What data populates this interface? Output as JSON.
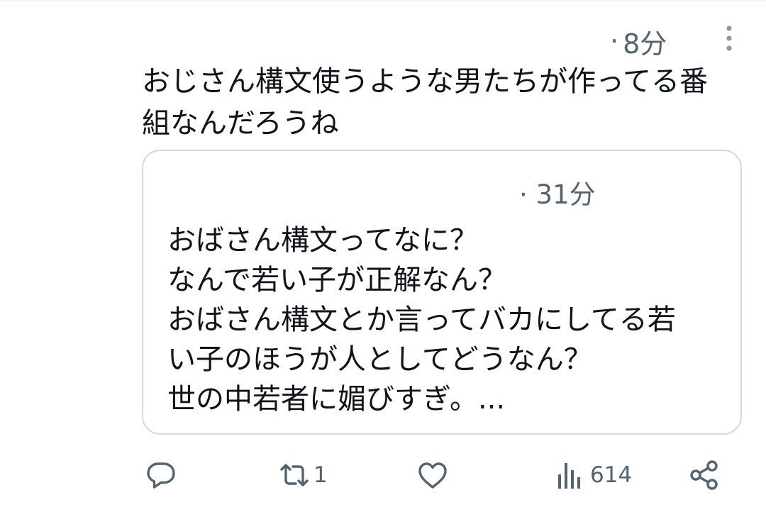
{
  "post": {
    "dot": "·",
    "time": "8分",
    "text": "おじさん構文使うような男たちが作ってる番\n組なんだろうね"
  },
  "quote": {
    "dot": "·",
    "time": "31分",
    "text": "おばさん構文ってなに？\nなんで若い子が正解なん？\nおばさん構文とか言ってバカにしてる若\nい子のほうが人としてどうなん？\n世の中若者に媚びすぎ。..."
  },
  "actions": {
    "reply_icon": "reply-icon",
    "retweet_icon": "retweet-icon",
    "retweet_count": "1",
    "like_icon": "like-icon",
    "views_icon": "views-icon",
    "views_count": "614",
    "share_icon": "share-icon"
  },
  "colors": {
    "text": "#0f1419",
    "secondary": "#536471",
    "border": "#cfd9de",
    "divider": "#eff3f4"
  }
}
